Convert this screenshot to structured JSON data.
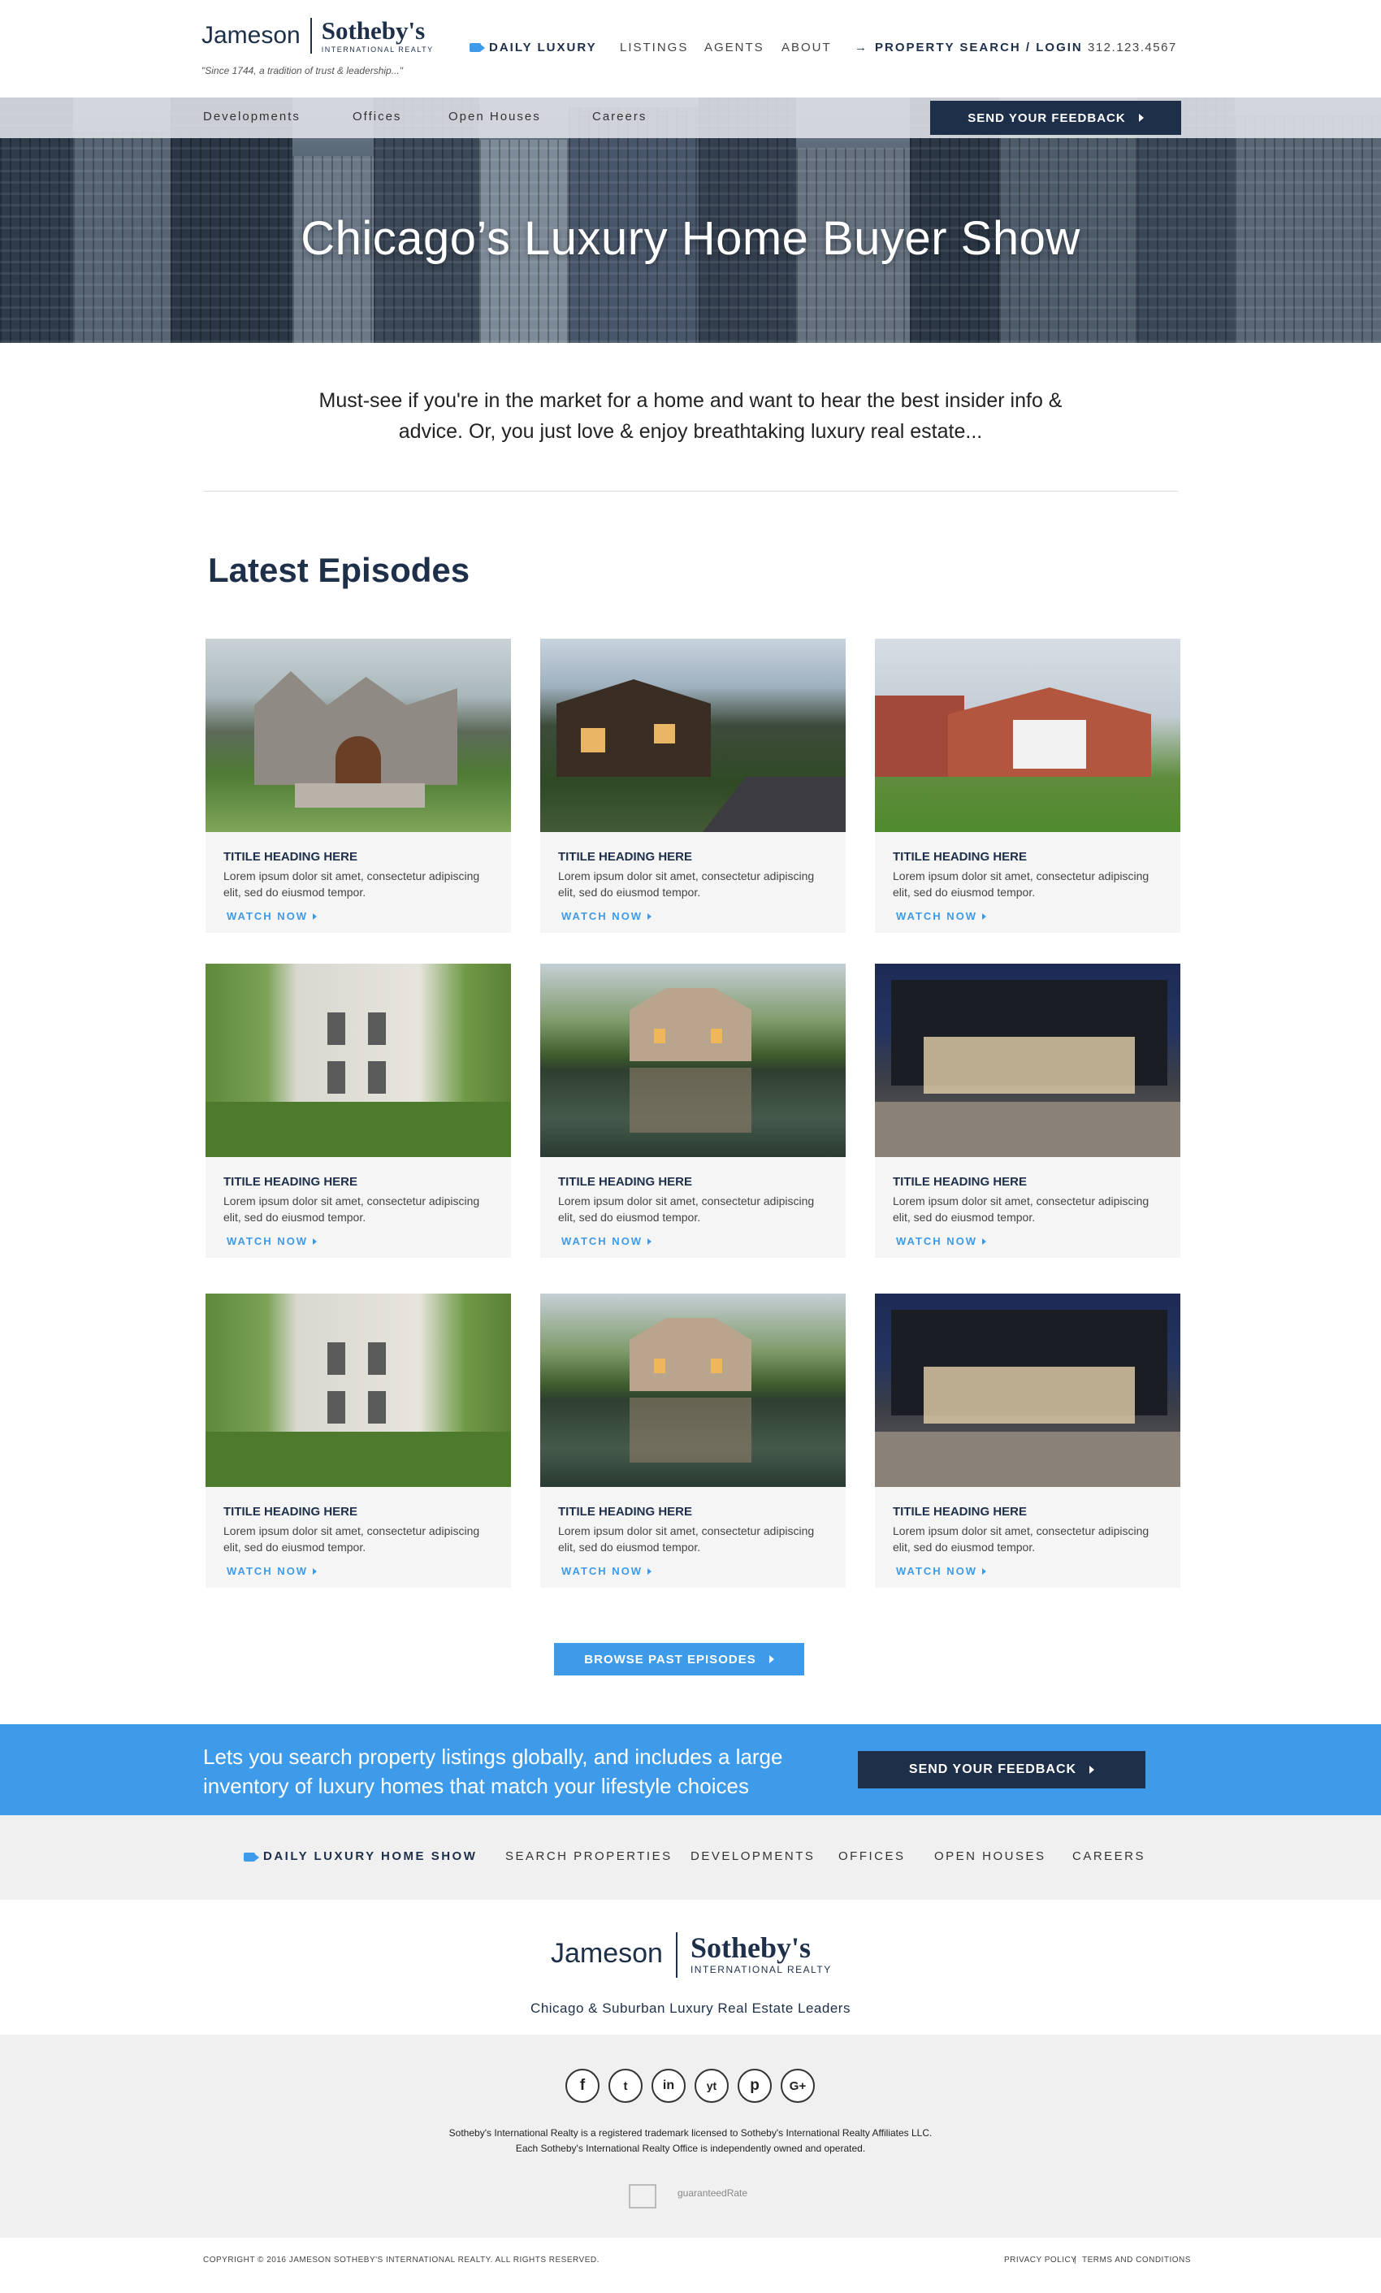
{
  "header": {
    "logo_left": "Jameson",
    "logo_right": "Sotheby's",
    "logo_sub": "INTERNATIONAL REALTY",
    "tagline": "\"Since 1744, a tradition of trust & leadership...\"",
    "nav": [
      "DAILY LUXURY",
      "LISTINGS",
      "AGENTS",
      "ABOUT",
      "PROPERTY SEARCH / LOGIN",
      "312.123.4567"
    ]
  },
  "subnav": {
    "items": [
      "Developments",
      "Offices",
      "Open Houses",
      "Careers"
    ],
    "feedback_label": "SEND YOUR FEEDBACK"
  },
  "hero": {
    "title": "Chicago’s Luxury Home Buyer Show"
  },
  "intro": "Must-see if you're in the market for a home and want to hear the best insider info & advice. Or, you just love & enjoy breathtaking luxury real estate...",
  "episodes": {
    "heading": "Latest Episodes",
    "card_title": "TITILE HEADING HERE",
    "card_desc": "Lorem ipsum dolor sit amet, consectetur adipiscing elit, sed do eiusmod tempor.",
    "card_link": "WATCH NOW",
    "browse_label": "BROWSE PAST EPISODES"
  },
  "band": {
    "text": "Lets you search property listings globally, and includes a large inventory of luxury homes that match your lifestyle choices",
    "button": "SEND YOUR FEEDBACK"
  },
  "footer_nav": [
    "DAILY LUXURY HOME SHOW",
    "SEARCH PROPERTIES",
    "DEVELOPMENTS",
    "OFFICES",
    "OPEN HOUSES",
    "CAREERS"
  ],
  "footer_logo": {
    "left": "Jameson",
    "right": "Sotheby's",
    "sub": "INTERNATIONAL REALTY",
    "tagline": "Chicago & Suburban Luxury Real Estate Leaders"
  },
  "social": [
    "f",
    "t",
    "in",
    "yt",
    "p",
    "G+"
  ],
  "legal": [
    "Sotheby's International Realty is a registered trademark licensed to Sotheby's International Realty Affiliates LLC.",
    "Each Sotheby's International Realty Office is independently owned and operated."
  ],
  "badge_text": "guaranteedRate",
  "bottom": {
    "copyright": "COPYRIGHT © 2016 JAMESON SOTHEBY'S INTERNATIONAL REALTY. ALL RIGHTS RESERVED.",
    "privacy": "PRIVACY POLICY",
    "sep": "|",
    "terms": "TERMS AND CONDITIONS"
  },
  "colors": {
    "navy": "#1e2f4a",
    "accent": "#3d9be9"
  }
}
